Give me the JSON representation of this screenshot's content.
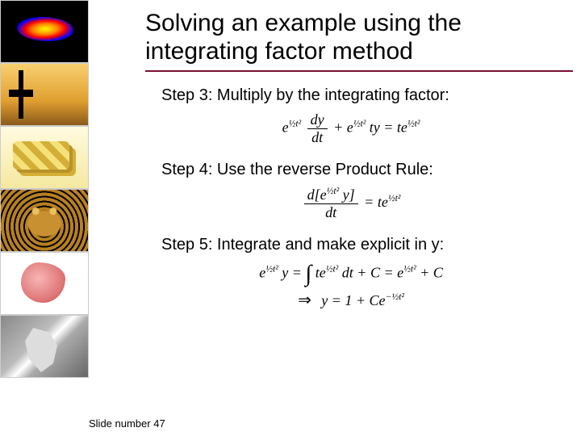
{
  "title": "Solving an example using the integrating factor method",
  "steps": {
    "s3": "Step 3: Multiply by the integrating factor:",
    "s4": "Step 4: Use the reverse Product Rule:",
    "s5": "Step 5: Integrate and make explicit in y:"
  },
  "equations": {
    "eq3_lhs_exp": "½t²",
    "eq3_frac_num": "dy",
    "eq3_frac_den": "dt",
    "eq3_plus": " + e",
    "eq3_ty": " ty = te",
    "eq4_frac_num_pre": "d[e",
    "eq4_frac_num_post": " y]",
    "eq4_frac_den": "dt",
    "eq4_rhs": " = te",
    "eq5a_lhs_pre": "e",
    "eq5a_lhs_post": " y = ",
    "eq5a_int_body": " te",
    "eq5a_dt": " dt + C = e",
    "eq5a_tail": " + C",
    "eq5b_arrow": "⇒",
    "eq5b_body_pre": " y = 1 + Ce",
    "eq5b_exp": "−½t²"
  },
  "footer": "Slide number 47",
  "thumbs": [
    "sim-thumb",
    "pumpjack-thumb",
    "gold-thumb",
    "leopard-thumb",
    "liver-thumb",
    "satellite-thumb"
  ]
}
